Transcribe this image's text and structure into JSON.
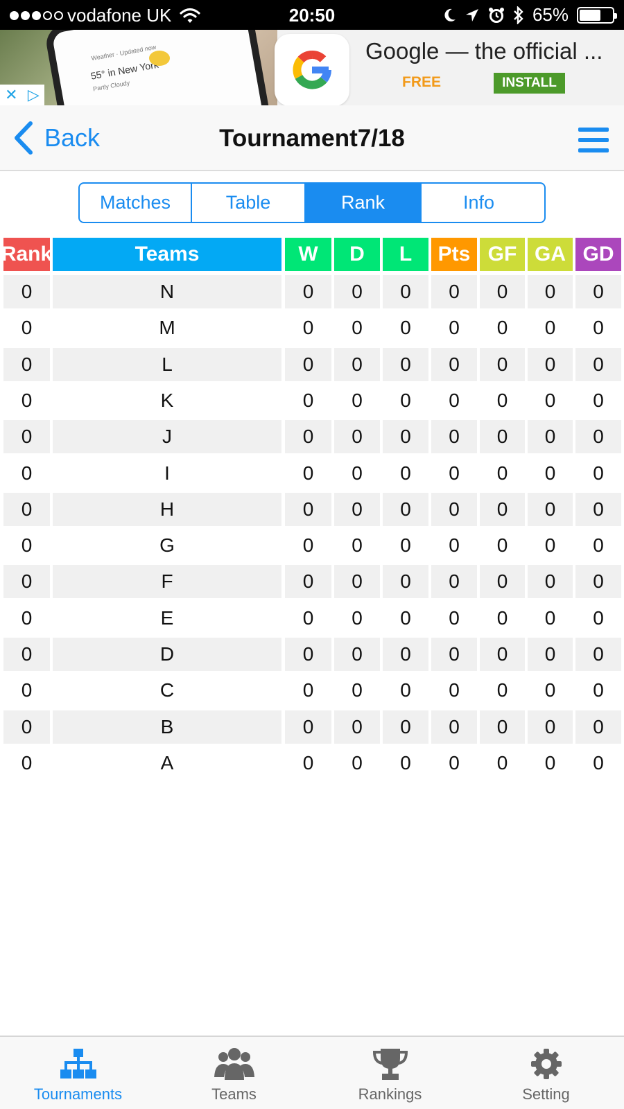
{
  "status_bar": {
    "carrier": "vodafone UK",
    "time": "20:50",
    "battery": "65%",
    "battery_level": 0.65
  },
  "ad": {
    "title": "Google — the official ...",
    "price": "FREE",
    "install_label": "INSTALL",
    "phone_header": "Weather · Updated now",
    "phone_temp": "55° in New York",
    "phone_condition": "Partly Cloudy",
    "close_glyph": "✕",
    "adchoices_glyph": "▷"
  },
  "navbar": {
    "back_label": "Back",
    "title": "Tournament7/18"
  },
  "segments": [
    {
      "label": "Matches",
      "active": false
    },
    {
      "label": "Table",
      "active": false
    },
    {
      "label": "Rank",
      "active": true
    },
    {
      "label": "Info",
      "active": false
    }
  ],
  "table": {
    "headers": [
      "Rank",
      "Teams",
      "W",
      "D",
      "L",
      "Pts",
      "GF",
      "GA",
      "GD"
    ],
    "header_colors": [
      "#ef5350",
      "#03a9f4",
      "#00e676",
      "#00e676",
      "#00e676",
      "#ff9800",
      "#cddc39",
      "#cddc39",
      "#ab47bc"
    ],
    "rows": [
      [
        "0",
        "N",
        "0",
        "0",
        "0",
        "0",
        "0",
        "0",
        "0"
      ],
      [
        "0",
        "M",
        "0",
        "0",
        "0",
        "0",
        "0",
        "0",
        "0"
      ],
      [
        "0",
        "L",
        "0",
        "0",
        "0",
        "0",
        "0",
        "0",
        "0"
      ],
      [
        "0",
        "K",
        "0",
        "0",
        "0",
        "0",
        "0",
        "0",
        "0"
      ],
      [
        "0",
        "J",
        "0",
        "0",
        "0",
        "0",
        "0",
        "0",
        "0"
      ],
      [
        "0",
        "I",
        "0",
        "0",
        "0",
        "0",
        "0",
        "0",
        "0"
      ],
      [
        "0",
        "H",
        "0",
        "0",
        "0",
        "0",
        "0",
        "0",
        "0"
      ],
      [
        "0",
        "G",
        "0",
        "0",
        "0",
        "0",
        "0",
        "0",
        "0"
      ],
      [
        "0",
        "F",
        "0",
        "0",
        "0",
        "0",
        "0",
        "0",
        "0"
      ],
      [
        "0",
        "E",
        "0",
        "0",
        "0",
        "0",
        "0",
        "0",
        "0"
      ],
      [
        "0",
        "D",
        "0",
        "0",
        "0",
        "0",
        "0",
        "0",
        "0"
      ],
      [
        "0",
        "C",
        "0",
        "0",
        "0",
        "0",
        "0",
        "0",
        "0"
      ],
      [
        "0",
        "B",
        "0",
        "0",
        "0",
        "0",
        "0",
        "0",
        "0"
      ],
      [
        "0",
        "A",
        "0",
        "0",
        "0",
        "0",
        "0",
        "0",
        "0"
      ]
    ]
  },
  "tabbar": {
    "items": [
      {
        "label": "Tournaments",
        "icon": "hierarchy-icon",
        "active": true
      },
      {
        "label": "Teams",
        "icon": "people-icon",
        "active": false
      },
      {
        "label": "Rankings",
        "icon": "trophy-icon",
        "active": false
      },
      {
        "label": "Setting",
        "icon": "gear-icon",
        "active": false
      }
    ]
  },
  "colors": {
    "accent": "#1a8cf0",
    "install_green": "#4c9a2a",
    "free_orange": "#f29a1a"
  }
}
